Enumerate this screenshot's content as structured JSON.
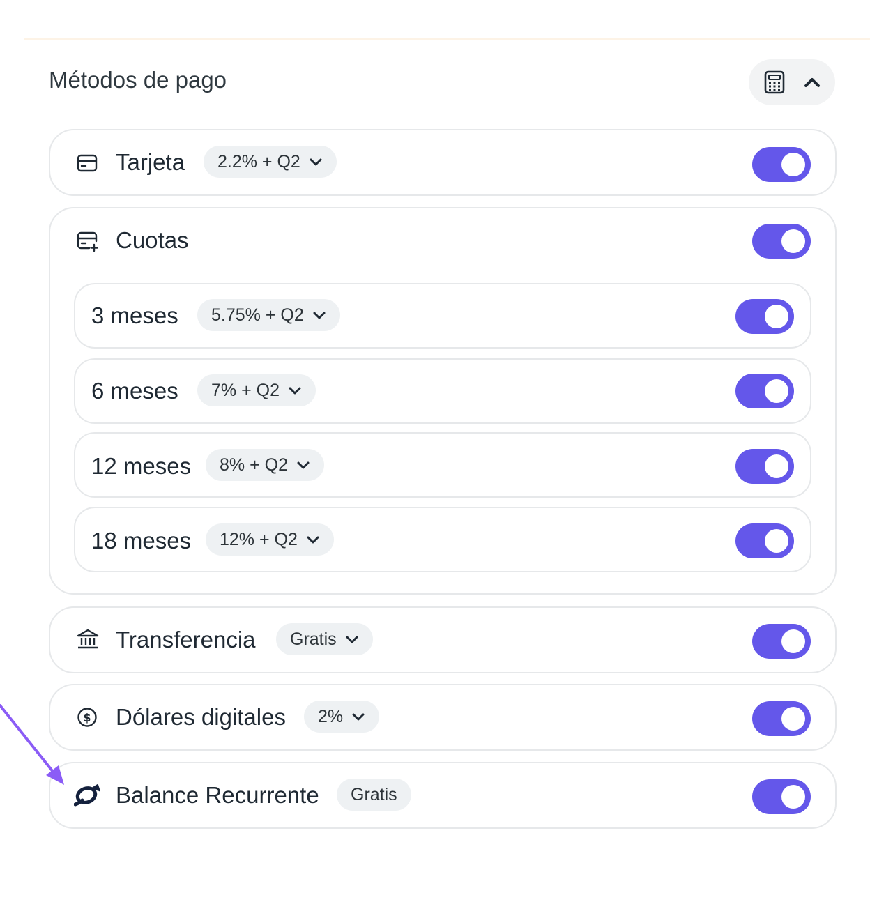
{
  "section": {
    "title": "Métodos de pago"
  },
  "header": {
    "icons": [
      "calculator-icon",
      "chevron-up-icon"
    ]
  },
  "methods": {
    "tarjeta": {
      "label": "Tarjeta",
      "fee": "2.2% + Q2",
      "enabled": true,
      "icon": "credit-card-icon"
    },
    "cuotas": {
      "label": "Cuotas",
      "enabled": true,
      "icon": "installments-card-icon",
      "plans": [
        {
          "label": "3 meses",
          "fee": "5.75% + Q2",
          "enabled": true
        },
        {
          "label": "6 meses",
          "fee": "7% + Q2",
          "enabled": true
        },
        {
          "label": "12 meses",
          "fee": "8% + Q2",
          "enabled": true
        },
        {
          "label": "18 meses",
          "fee": "12% + Q2",
          "enabled": true
        }
      ]
    },
    "transferencia": {
      "label": "Transferencia",
      "fee": "Gratis",
      "enabled": true,
      "icon": "bank-icon"
    },
    "dolares": {
      "label": "Dólares digitales",
      "fee": "2%",
      "enabled": true,
      "icon": "dollar-circle-icon"
    },
    "balance": {
      "label": "Balance Recurrente",
      "fee": "Gratis",
      "enabled": true,
      "icon": "recurrente-logo-icon"
    }
  },
  "colors": {
    "toggle_on": "#6457ea",
    "pill_bg": "#eef1f3",
    "annotation_arrow": "#8b5cf6"
  }
}
